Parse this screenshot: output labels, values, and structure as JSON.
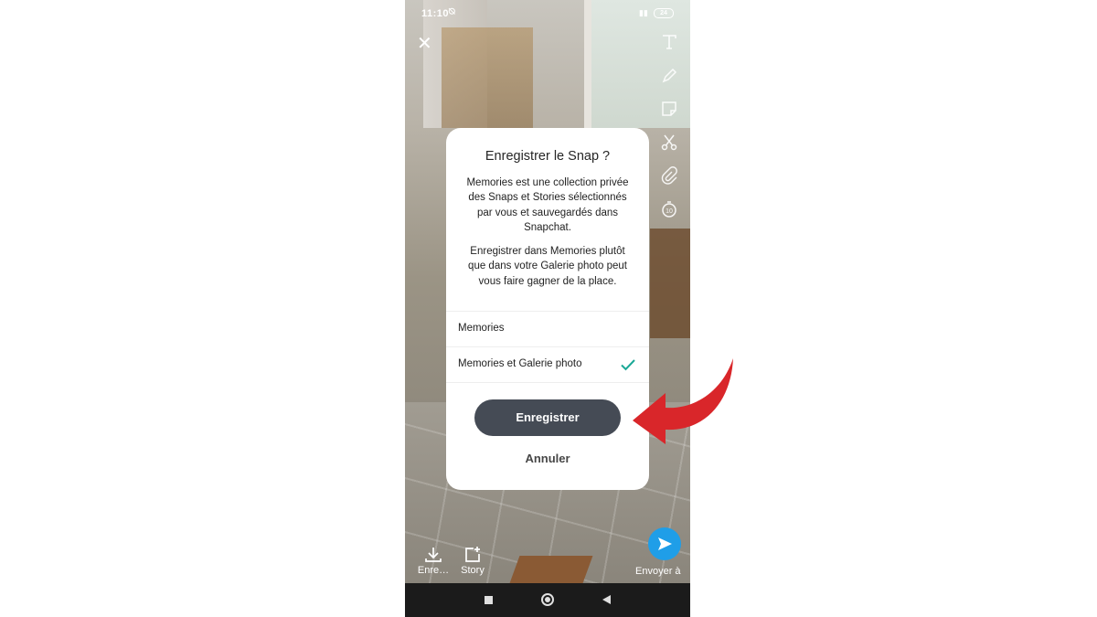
{
  "status_bar": {
    "time": "11:10",
    "battery": "24"
  },
  "dialog": {
    "title": "Enregistrer le Snap ?",
    "paragraph1": "Memories est une collection privée des Snaps et Stories sélectionnés par vous et sauvegardés dans Snapchat.",
    "paragraph2": "Enregistrer dans Memories plutôt que dans votre Galerie photo peut vous faire gagner de la place.",
    "options": [
      {
        "label": "Memories",
        "selected": false
      },
      {
        "label": "Memories et Galerie photo",
        "selected": true
      }
    ],
    "save_label": "Enregistrer",
    "cancel_label": "Annuler"
  },
  "bottom_bar": {
    "save_label": "Enre…",
    "story_label": "Story",
    "send_label": "Envoyer à"
  },
  "colors": {
    "primary_button": "#454b55",
    "check": "#1aa896",
    "send": "#1f9ee8",
    "annotation_arrow": "#d9262a"
  },
  "icons": [
    "close-icon",
    "text-icon",
    "pencil-icon",
    "sticker-icon",
    "scissors-icon",
    "paperclip-icon",
    "timer-icon",
    "check-icon",
    "download-icon",
    "story-add-icon",
    "send-icon"
  ]
}
